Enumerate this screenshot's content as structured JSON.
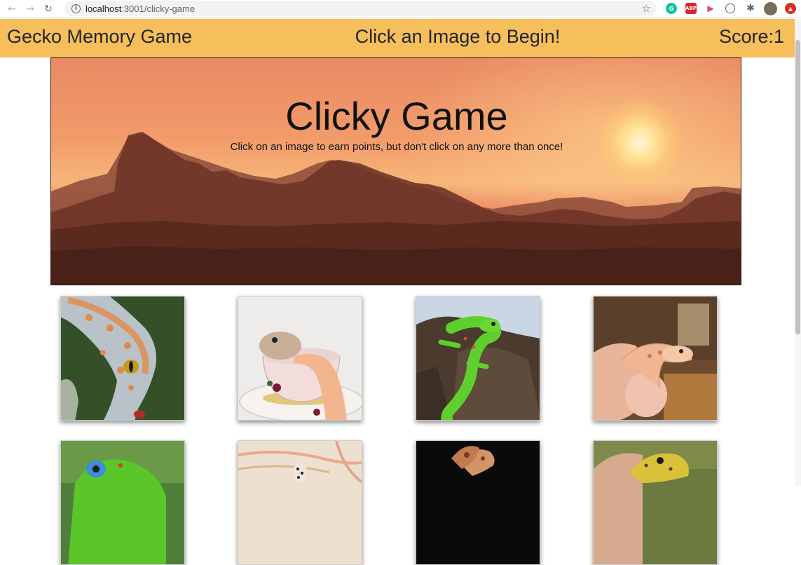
{
  "browser": {
    "url_host": "localhost",
    "url_path": ":3001/clicky-game"
  },
  "navbar": {
    "brand": "Gecko Memory Game",
    "message": "Click an Image to Begin!",
    "score_label": "Score:1"
  },
  "jumbotron": {
    "title": "Clicky Game",
    "subtitle": "Click on an image to earn points, but don't click on any more than once!"
  },
  "cards": [
    {
      "icon": "tokay-gecko-image"
    },
    {
      "icon": "gecko-in-teacup-image"
    },
    {
      "icon": "green-day-gecko-image"
    },
    {
      "icon": "leopard-gecko-in-hand-image"
    },
    {
      "icon": "green-gecko-closeup-image"
    },
    {
      "icon": "spotted-gecko-on-sand-image"
    },
    {
      "icon": "gecko-on-black-image"
    },
    {
      "icon": "yellow-gecko-in-hand-image"
    }
  ],
  "colors": {
    "navbar_bg": "#f6bf5b",
    "text": "#212529"
  }
}
